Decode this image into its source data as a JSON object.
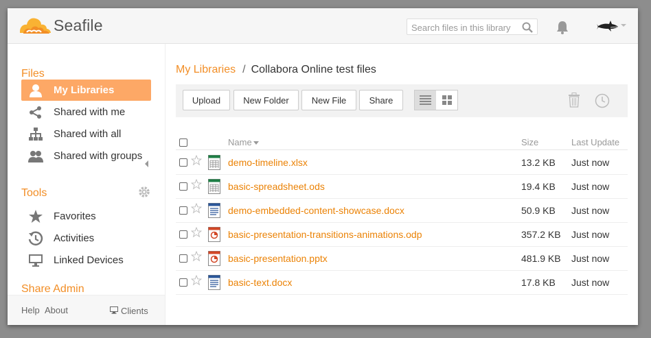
{
  "app": {
    "name": "Seafile"
  },
  "header": {
    "search_placeholder": "Search files in this library"
  },
  "sidebar": {
    "files_heading": "Files",
    "files_items": [
      {
        "label": "My Libraries",
        "icon": "user-icon",
        "active": true
      },
      {
        "label": "Shared with me",
        "icon": "share-icon"
      },
      {
        "label": "Shared with all",
        "icon": "org-chart-icon"
      },
      {
        "label": "Shared with groups",
        "icon": "group-icon"
      }
    ],
    "tools_heading": "Tools",
    "tools_items": [
      {
        "label": "Favorites",
        "icon": "star-icon"
      },
      {
        "label": "Activities",
        "icon": "history-icon"
      },
      {
        "label": "Linked Devices",
        "icon": "monitor-icon"
      }
    ],
    "share_admin_heading": "Share Admin",
    "footer": {
      "help": "Help",
      "about": "About",
      "clients": "Clients"
    }
  },
  "main": {
    "breadcrumb": {
      "root": "My Libraries",
      "separator": "/",
      "current": "Collabora Online test files"
    },
    "toolbar": {
      "upload": "Upload",
      "new_folder": "New Folder",
      "new_file": "New File",
      "share": "Share"
    },
    "table": {
      "headers": {
        "name": "Name",
        "size": "Size",
        "last_update": "Last Update"
      },
      "rows": [
        {
          "name": "demo-timeline.xlsx",
          "size": "13.2 KB",
          "updated": "Just now",
          "type": "spreadsheet"
        },
        {
          "name": "basic-spreadsheet.ods",
          "size": "19.4 KB",
          "updated": "Just now",
          "type": "spreadsheet"
        },
        {
          "name": "demo-embedded-content-showcase.docx",
          "size": "50.9 KB",
          "updated": "Just now",
          "type": "document"
        },
        {
          "name": "basic-presentation-transitions-animations.odp",
          "size": "357.2 KB",
          "updated": "Just now",
          "type": "presentation"
        },
        {
          "name": "basic-presentation.pptx",
          "size": "481.9 KB",
          "updated": "Just now",
          "type": "presentation"
        },
        {
          "name": "basic-text.docx",
          "size": "17.8 KB",
          "updated": "Just now",
          "type": "document"
        }
      ]
    }
  },
  "colors": {
    "accent": "#f28e26",
    "active_bg": "#fda866",
    "link": "#eb8205"
  }
}
